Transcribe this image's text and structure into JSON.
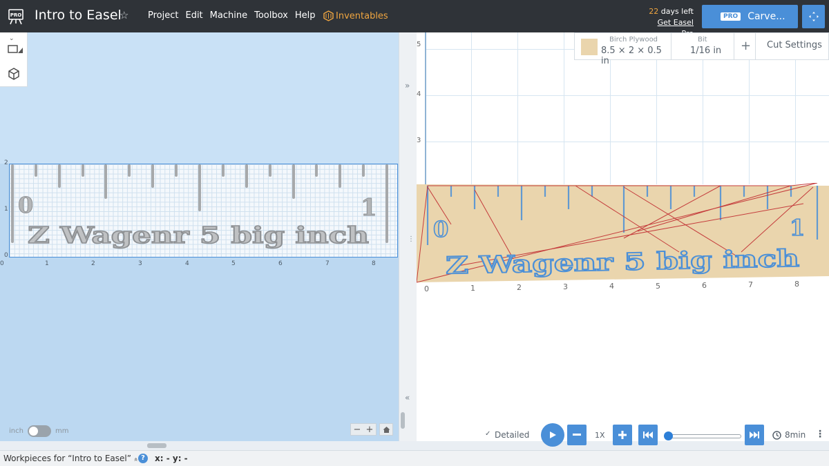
{
  "app": {
    "title": "Intro to Easel",
    "logo_badge": "PRO",
    "star_glyph": "☆",
    "menu": [
      "Project",
      "Edit",
      "Machine",
      "Toolbox",
      "Help"
    ],
    "inventables_label": "Inventables",
    "trial_days": "22",
    "trial_suffix": "days left",
    "get_pro_link": "Get Easel Pro",
    "carve_badge": "PRO",
    "carve_label": "Carve...",
    "accent_color": "#4a8fd8",
    "orange_color": "#f0a640"
  },
  "design": {
    "ruler_number_left": "0",
    "ruler_number_right": "1",
    "text": "Z Wagenr 5 big inch",
    "x_ticks": [
      "0",
      "1",
      "2",
      "3",
      "4",
      "5",
      "6",
      "7",
      "8"
    ],
    "y_ticks": [
      "0",
      "1",
      "2"
    ],
    "unit_left": "inch",
    "unit_right": "mm",
    "zoom_minus": "−",
    "zoom_plus": "+"
  },
  "preview": {
    "material_label": "Birch Plywood",
    "material_dims": "8.5 × 2 × 0.5 in",
    "bit_label": "Bit",
    "bit_value": "1/16 in",
    "add_glyph": "+",
    "cut_settings": "Cut Settings",
    "ruler_number_left": "0",
    "ruler_number_right": "1",
    "text": "Z Wagenr 5 big inch",
    "x_ticks": [
      "0",
      "1",
      "2",
      "3",
      "4",
      "5",
      "6",
      "7",
      "8"
    ],
    "y_ticks": [
      "3",
      "4",
      "5"
    ],
    "detailed_label": "Detailed",
    "speed_label": "1X",
    "time_label": "8min",
    "material_color": "#ead5ad"
  },
  "status": {
    "workpieces": "Workpieces for “Intro to Easel”",
    "caret": "»",
    "help": "?",
    "coords": "x: - y: -"
  }
}
